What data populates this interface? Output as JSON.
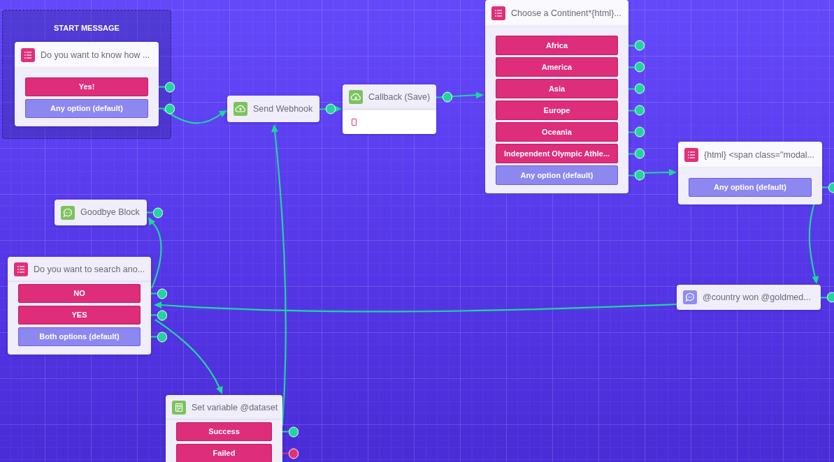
{
  "canvas": {
    "groups": [
      {
        "title": "START MESSAGE"
      }
    ],
    "nodes": [
      {
        "kind": "question",
        "title": "Do you want to know how ...",
        "options": [
          {
            "label": "Yes!",
            "kind": "choice"
          },
          {
            "label": "Any option (default)",
            "kind": "default"
          }
        ]
      },
      {
        "kind": "webhook",
        "title": "Send Webhook"
      },
      {
        "kind": "callback",
        "title": "Callback (Save)"
      },
      {
        "kind": "question",
        "title": "Choose a Continent*{html}...",
        "options": [
          {
            "label": "Africa",
            "kind": "choice"
          },
          {
            "label": "America",
            "kind": "choice"
          },
          {
            "label": "Asia",
            "kind": "choice"
          },
          {
            "label": "Europe",
            "kind": "choice"
          },
          {
            "label": "Oceania",
            "kind": "choice"
          },
          {
            "label": "Independent Olympic Athle...",
            "kind": "choice"
          },
          {
            "label": "Any option (default)",
            "kind": "default"
          }
        ]
      },
      {
        "kind": "question",
        "title": "{html} <span class=\"modal...",
        "options": [
          {
            "label": "Any option (default)",
            "kind": "default"
          }
        ]
      },
      {
        "kind": "goodbye",
        "title": "Goodbye Block"
      },
      {
        "kind": "question",
        "title": "Do you want to search ano...",
        "options": [
          {
            "label": "NO",
            "kind": "choice"
          },
          {
            "label": "YES",
            "kind": "choice"
          },
          {
            "label": "Both options (default)",
            "kind": "default"
          }
        ]
      },
      {
        "kind": "message",
        "title": "@country won @goldmed..."
      },
      {
        "kind": "variable",
        "title": "Set variable @dataset",
        "options": [
          {
            "label": "Success",
            "kind": "choice",
            "color": "#1fd69e"
          },
          {
            "label": "Failed",
            "kind": "choice",
            "color": "#e5306f"
          }
        ]
      }
    ]
  }
}
